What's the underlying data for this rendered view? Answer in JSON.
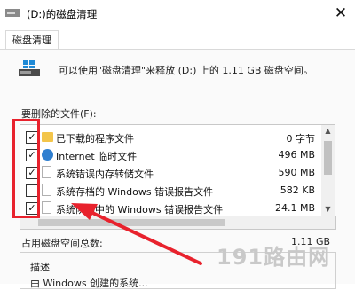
{
  "window": {
    "title": "(D:)的磁盘清理",
    "close_glyph": "✕"
  },
  "tabs": [
    {
      "label": "磁盘清理"
    }
  ],
  "summary_text": "可以使用\"磁盘清理\"来释放  (D:) 上的 1.11 GB 磁盘空间。",
  "files_label": "要删除的文件(F):",
  "file_list": [
    {
      "name": "已下载的程序文件",
      "size": "0 字节",
      "checked": true,
      "icon": "folder-icon"
    },
    {
      "name": "Internet 临时文件",
      "size": "496 MB",
      "checked": true,
      "icon": "globe-icon"
    },
    {
      "name": "系统错误内存转储文件",
      "size": "590 MB",
      "checked": true,
      "icon": "file-icon"
    },
    {
      "name": "系统存档的 Windows 错误报告文件",
      "size": "582 KB",
      "checked": false,
      "icon": "file-icon"
    },
    {
      "name": "系统队列中的 Windows 错误报告文件",
      "size": "24.1 MB",
      "checked": true,
      "icon": "file-icon"
    }
  ],
  "space_label": "占用磁盘空间总数:",
  "space_value": "1.11 GB",
  "description_label": "描述",
  "description_text": "由 Windows 创建的系统...",
  "watermark": "191路由网",
  "colors": {
    "annotation": "#e8222d",
    "accent": "#2f7fd0"
  }
}
